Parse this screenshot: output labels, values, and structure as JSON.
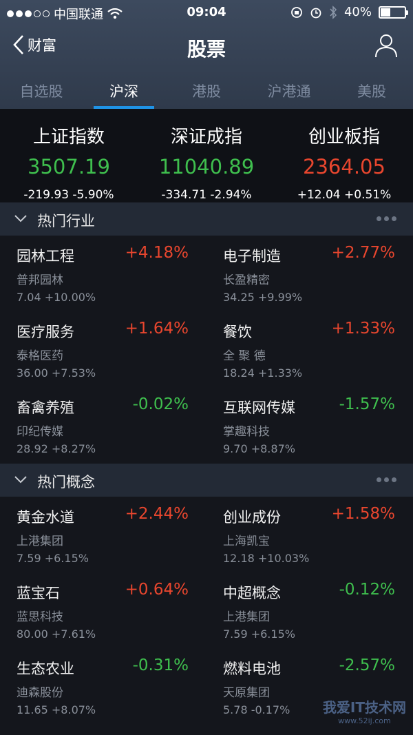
{
  "status_bar": {
    "carrier": "中国联通",
    "time": "09:04",
    "battery": "40%",
    "battery_level": 0.4
  },
  "nav": {
    "back_label": "财富",
    "title": "股票"
  },
  "tabs": [
    {
      "label": "自选股"
    },
    {
      "label": "沪深"
    },
    {
      "label": "港股"
    },
    {
      "label": "沪港通"
    },
    {
      "label": "美股"
    }
  ],
  "active_tab": 1,
  "indices": [
    {
      "name": "上证指数",
      "value": "3507.19",
      "change": "-219.93 -5.90%",
      "color": "#3fbf4e"
    },
    {
      "name": "深证成指",
      "value": "11040.89",
      "change": "-334.71 -2.94%",
      "color": "#3fbf4e"
    },
    {
      "name": "创业板指",
      "value": "2364.05",
      "change": "+12.04 +0.51%",
      "color": "#e8462e"
    }
  ],
  "sections": [
    {
      "title": "热门行业",
      "items": [
        {
          "name": "园林工程",
          "pct": "+4.18%",
          "stock": "普邦园林",
          "price_change": "7.04 +10.00%"
        },
        {
          "name": "电子制造",
          "pct": "+2.77%",
          "stock": "长盈精密",
          "price_change": "34.25 +9.99%"
        },
        {
          "name": "医疗服务",
          "pct": "+1.64%",
          "stock": "泰格医药",
          "price_change": "36.00 +7.53%"
        },
        {
          "name": "餐饮",
          "pct": "+1.33%",
          "stock": "全 聚 德",
          "price_change": "18.24 +1.33%"
        },
        {
          "name": "畜禽养殖",
          "pct": "-0.02%",
          "stock": "印纪传媒",
          "price_change": "28.92 +8.27%"
        },
        {
          "name": "互联网传媒",
          "pct": "-1.57%",
          "stock": "掌趣科技",
          "price_change": "9.70 +8.87%"
        }
      ]
    },
    {
      "title": "热门概念",
      "items": [
        {
          "name": "黄金水道",
          "pct": "+2.44%",
          "stock": "上港集团",
          "price_change": "7.59 +6.15%"
        },
        {
          "name": "创业成份",
          "pct": "+1.58%",
          "stock": "上海凯宝",
          "price_change": "12.18 +10.03%"
        },
        {
          "name": "蓝宝石",
          "pct": "+0.64%",
          "stock": "蓝思科技",
          "price_change": "80.00 +7.61%"
        },
        {
          "name": "中超概念",
          "pct": "-0.12%",
          "stock": "上港集团",
          "price_change": "7.59 +6.15%"
        },
        {
          "name": "生态农业",
          "pct": "-0.31%",
          "stock": "迪森股份",
          "price_change": "11.65 +8.07%"
        },
        {
          "name": "燃料电池",
          "pct": "-2.57%",
          "stock": "天原集团",
          "price_change": "5.78 -0.17%"
        }
      ]
    }
  ],
  "watermark": {
    "text": "我爱IT技术网",
    "url": "www.52ij.com"
  },
  "colors": {
    "up": "#e8462e",
    "down": "#3fbf4e",
    "accent": "#1f93e6"
  }
}
